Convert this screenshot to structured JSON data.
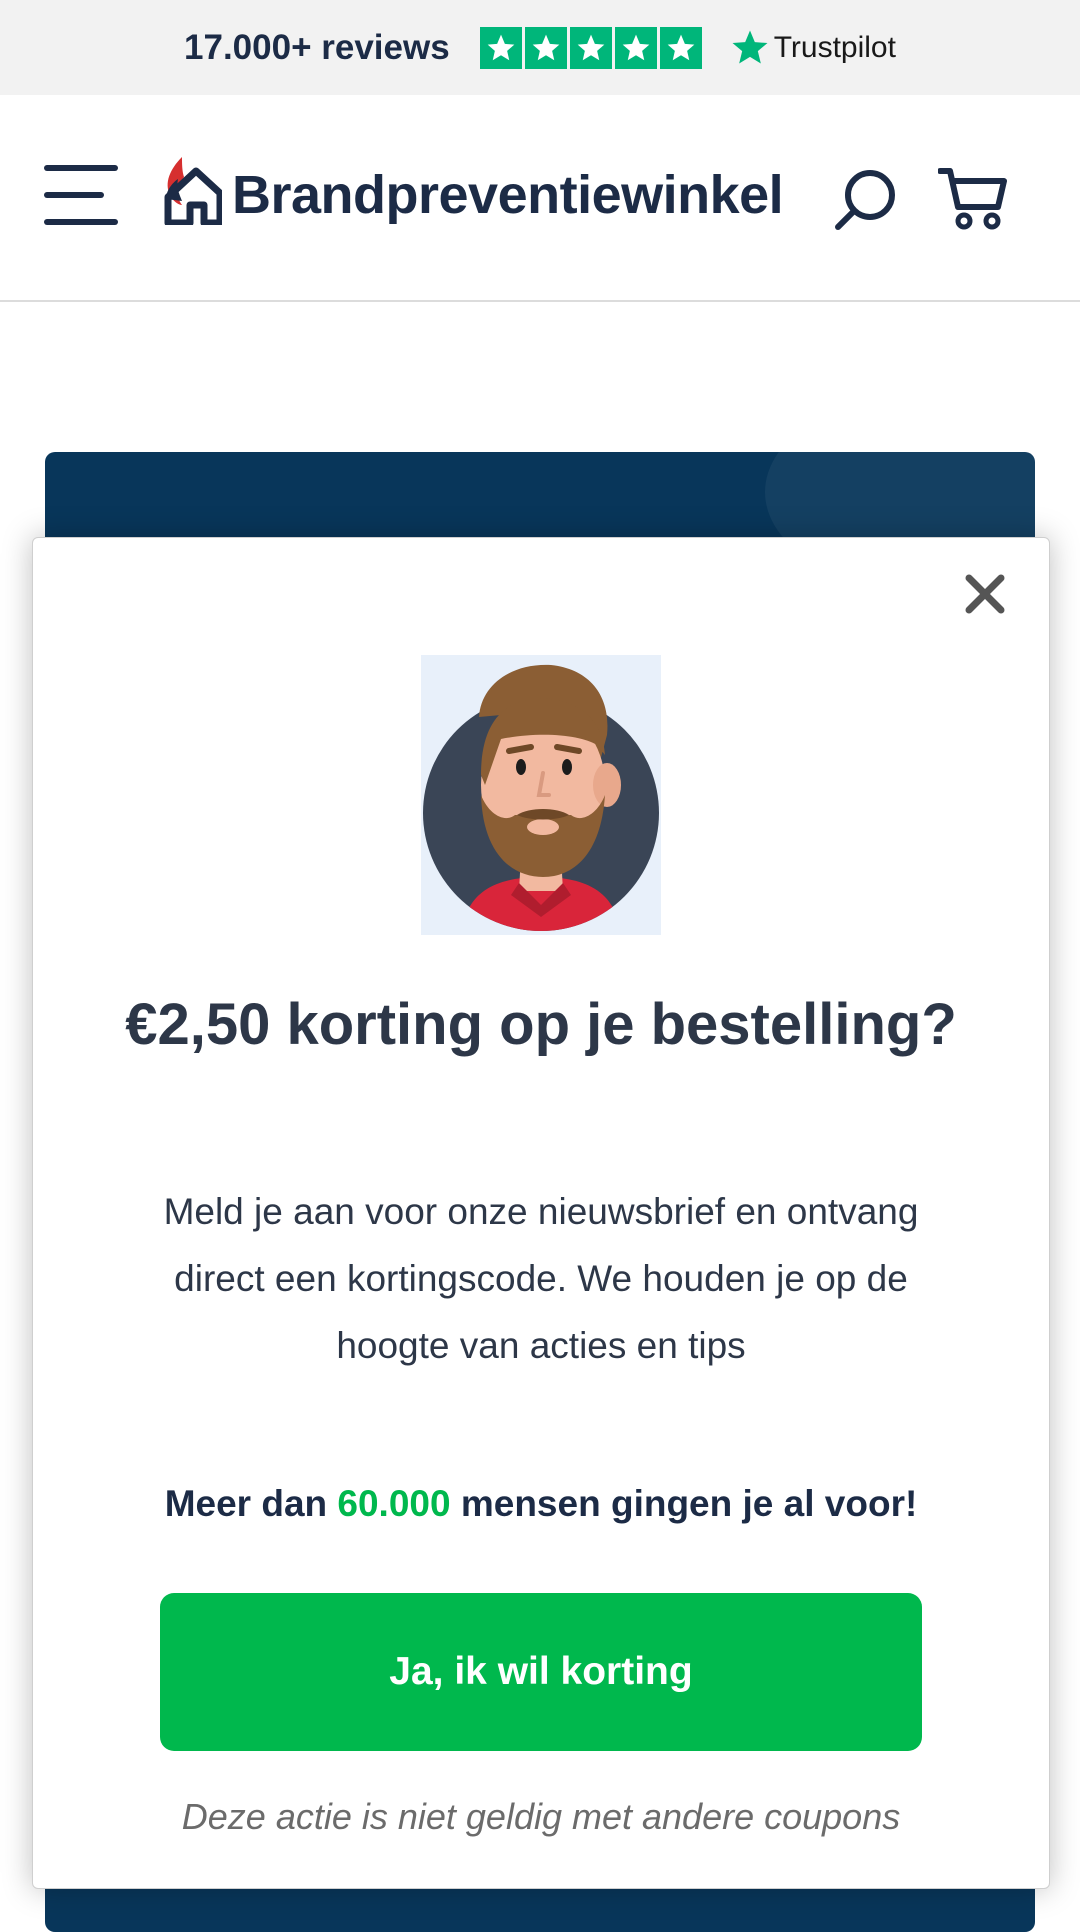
{
  "reviews": {
    "count_text": "17.000+ reviews",
    "star_count": 5,
    "star_color": "#00b67a",
    "provider": "Trustpilot"
  },
  "header": {
    "brand": "Brandpreventiewinkel",
    "icons": [
      "menu-icon",
      "search-icon",
      "cart-icon"
    ],
    "accent_color": "#1c2b46",
    "flame_color": "#d62f2f"
  },
  "modal": {
    "title": "€2,50 korting op je bestelling?",
    "description": "Meld je aan voor onze nieuwsbrief en ontvang direct een kortingscode. We houden je op de hoogte van acties en tips",
    "social_proof": {
      "prefix": "Meer dan ",
      "number": "60.000",
      "suffix": " mensen gingen je al voor!"
    },
    "cta_label": "Ja, ik wil korting",
    "cta_color": "#00b84d",
    "disclaimer": "Deze actie is niet geldig met andere coupons",
    "close_icon": "close-icon",
    "avatar_icon": "bearded-man-avatar"
  }
}
